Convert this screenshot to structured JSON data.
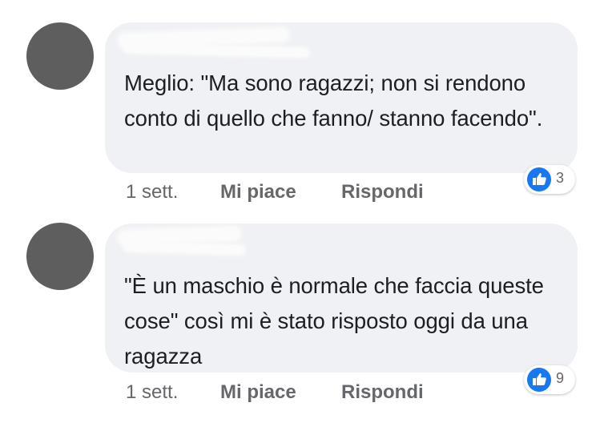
{
  "comments": [
    {
      "text": "Meglio: \"Ma sono ragazzi; non si rendono conto di quello che fanno/ stanno facendo\".",
      "time": "1 sett.",
      "like_label": "Mi piace",
      "reply_label": "Rispondi",
      "reaction_count": "3"
    },
    {
      "text": "\"È un maschio è normale che faccia queste cose\" così mi è stato risposto oggi da una ragazza",
      "time": "1 sett.",
      "like_label": "Mi piace",
      "reply_label": "Rispondi",
      "reaction_count": "9"
    }
  ],
  "colors": {
    "bubble": "#eff1f4",
    "avatar": "#5e5e5e",
    "like_blue": "#1877f2",
    "meta_text": "#65676b"
  },
  "icons": {
    "reaction": "thumbs-up-icon"
  }
}
